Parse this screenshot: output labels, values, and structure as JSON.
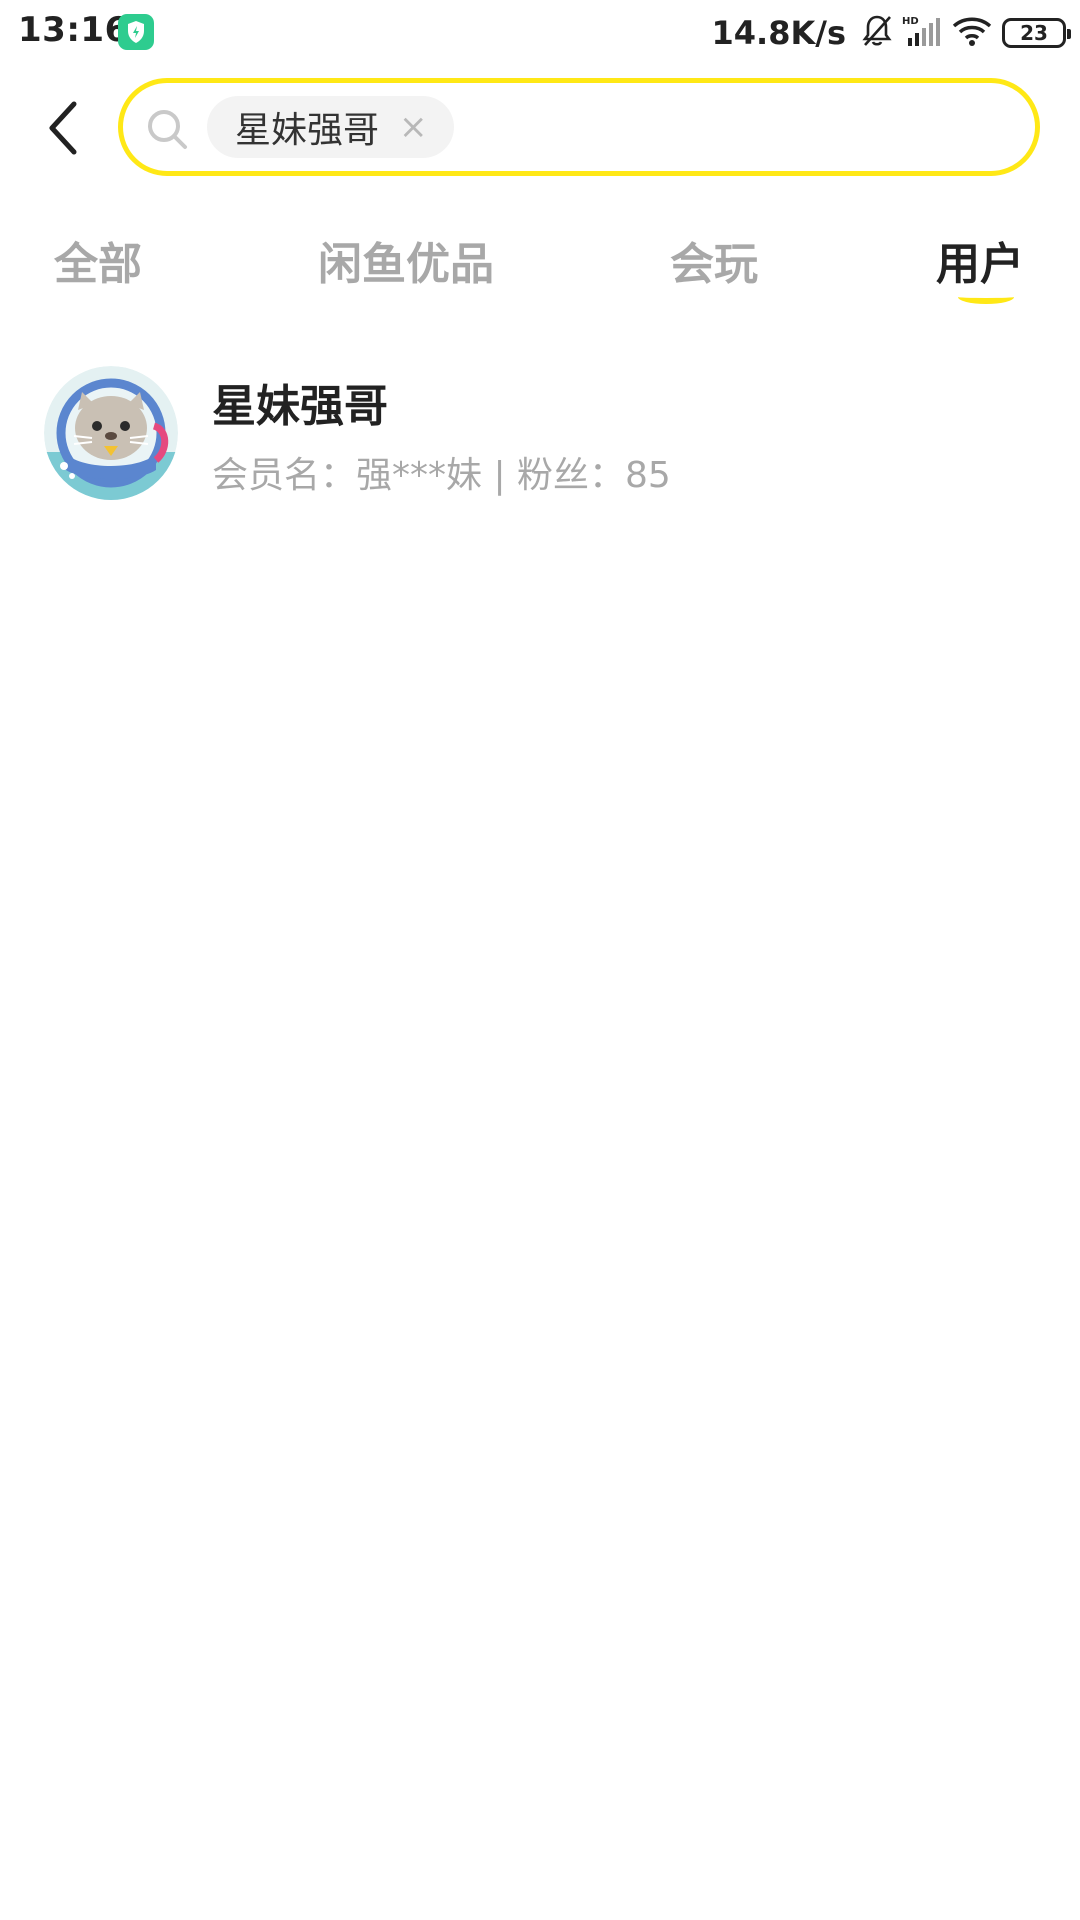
{
  "status_bar": {
    "time": "13:16",
    "net_speed": "14.8K/s",
    "battery": "23"
  },
  "search": {
    "query": "星妹强哥",
    "clear_symbol": "×"
  },
  "tabs": [
    {
      "label": "全部",
      "active": false
    },
    {
      "label": "闲鱼优品",
      "active": false
    },
    {
      "label": "会玩",
      "active": false
    },
    {
      "label": "用户",
      "active": true
    }
  ],
  "results": [
    {
      "name": "星妹强哥",
      "meta": "会员名：强***妹 | 粉丝：85",
      "avatar": "cat-astronaut-avatar"
    }
  ],
  "colors": {
    "accent": "#ffe816",
    "inactive_tab": "#a8a8a8",
    "primary_text": "#222222",
    "chip_bg": "#f3f3f3",
    "app_icon": "#2ecc8f"
  }
}
